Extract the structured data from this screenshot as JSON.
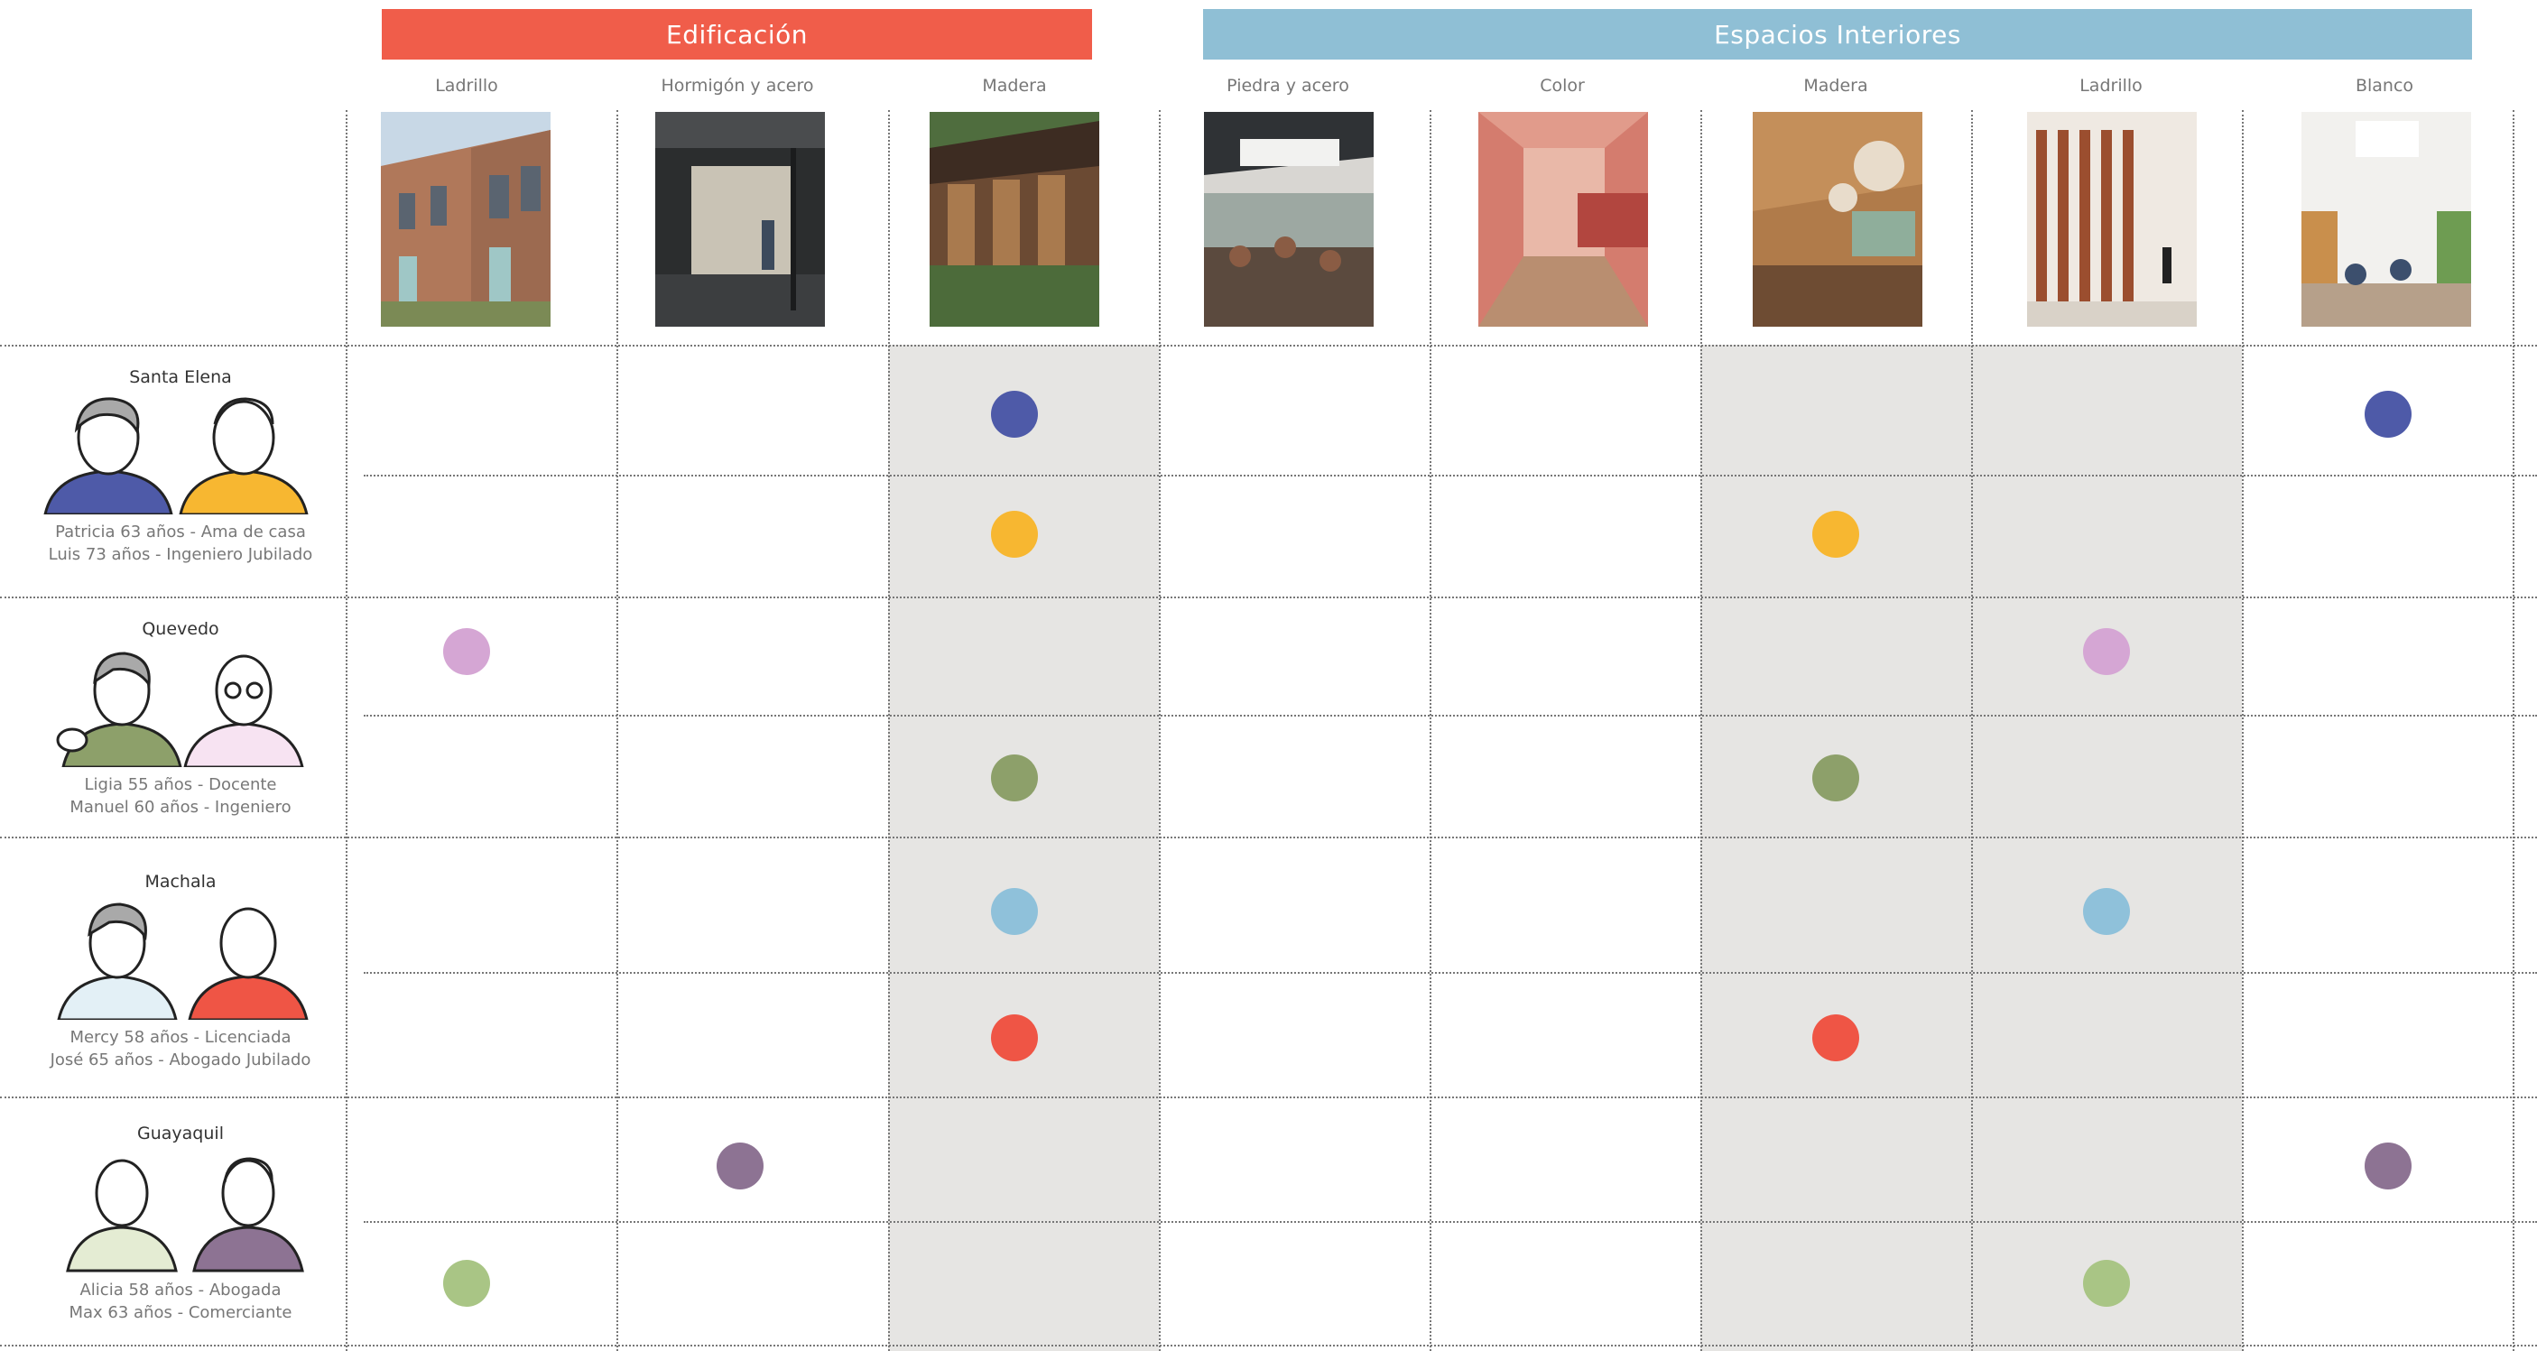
{
  "headers": {
    "edificacion": {
      "label": "Edificación",
      "color": "#f05d4a"
    },
    "espacios": {
      "label": "Espacios Interiores",
      "color": "#8fbfd5"
    }
  },
  "columns": [
    {
      "label": "Ladrillo",
      "group": "edificacion",
      "photo": "brick-building"
    },
    {
      "label": "Hormigón y acero",
      "group": "edificacion",
      "photo": "concrete-steel-porch"
    },
    {
      "label": "Madera",
      "group": "edificacion",
      "photo": "timber-building"
    },
    {
      "label": "Piedra y acero",
      "group": "espacios",
      "photo": "dining-hall"
    },
    {
      "label": "Color",
      "group": "espacios",
      "photo": "pink-corridor"
    },
    {
      "label": "Madera",
      "group": "espacios",
      "photo": "wood-lounge"
    },
    {
      "label": "Ladrillo",
      "group": "espacios",
      "photo": "brick-lattice-hall"
    },
    {
      "label": "Blanco",
      "group": "espacios",
      "photo": "white-atrium"
    }
  ],
  "highlighted_columns": [
    2,
    5,
    6
  ],
  "groups": [
    {
      "name": "Santa  Elena",
      "caption": [
        "Patricia 63 años - Ama de casa",
        "Luis 73 años - Ingeniero Jubilado"
      ],
      "persons": [
        {
          "shirt": "#4e5aa8"
        },
        {
          "shirt": "#f7b731"
        }
      ]
    },
    {
      "name": "Quevedo",
      "caption": [
        "Ligia 55 años - Docente",
        "Manuel 60 años - Ingeniero"
      ],
      "persons": [
        {
          "shirt": "#8da06a"
        },
        {
          "shirt": "#e3b7d8"
        }
      ]
    },
    {
      "name": "Machala",
      "caption": [
        "Mercy 58 años - Licenciada",
        "José 65 años - Abogado Jubilado"
      ],
      "persons": [
        {
          "shirt": "#9ec8dc"
        },
        {
          "shirt": "#ef5545"
        }
      ]
    },
    {
      "name": "Guayaquil",
      "caption": [
        "Alicia 58 años - Abogada",
        "Max 63 años - Comerciante"
      ],
      "persons": [
        {
          "shirt": "#b5c98f"
        },
        {
          "shirt": "#8d7393"
        }
      ]
    }
  ],
  "rows": [
    {
      "person": "Patricia",
      "color": "#4e5aa8",
      "choices": [
        2,
        7
      ]
    },
    {
      "person": "Luis",
      "color": "#f7b731",
      "choices": [
        2,
        5
      ]
    },
    {
      "person": "Ligia",
      "color": "#d5a6d4",
      "choices": [
        0,
        6
      ]
    },
    {
      "person": "Manuel",
      "color": "#8da06a",
      "choices": [
        2,
        5
      ]
    },
    {
      "person": "Mercy",
      "color": "#8fc1da",
      "choices": [
        2,
        6
      ]
    },
    {
      "person": "José",
      "color": "#ef5545",
      "choices": [
        2,
        5
      ]
    },
    {
      "person": "Alicia",
      "color": "#8d7393",
      "choices": [
        1,
        7
      ]
    },
    {
      "person": "Max",
      "color": "#a9c585",
      "choices": [
        0,
        6
      ]
    }
  ]
}
